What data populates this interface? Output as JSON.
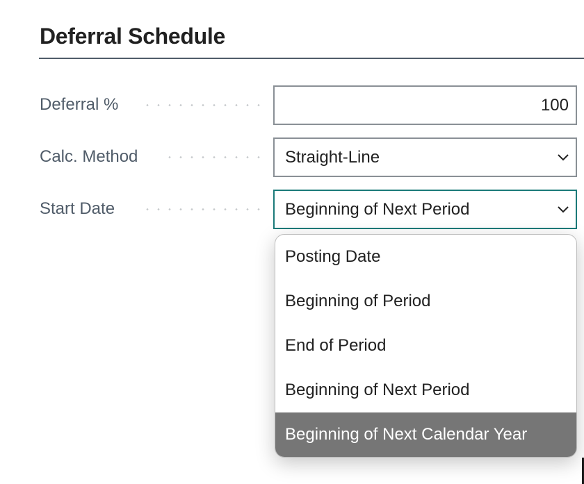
{
  "section": {
    "title": "Deferral Schedule"
  },
  "fields": [
    {
      "label": "Deferral %",
      "value": "100",
      "type": "number"
    },
    {
      "label": "Calc. Method",
      "value": "Straight-Line",
      "type": "select"
    },
    {
      "label": "Start Date",
      "value": "Beginning of Next Period",
      "type": "select",
      "focused": true
    }
  ],
  "dropdown": {
    "options": [
      "Posting Date",
      "Beginning of Period",
      "End of Period",
      "Beginning of Next Period",
      "Beginning of Next Calendar Year"
    ],
    "highlighted": "Beginning of Next Calendar Year"
  },
  "colors": {
    "focus": "#1b7a79",
    "highlight": "#767676",
    "label": "#505c69"
  }
}
